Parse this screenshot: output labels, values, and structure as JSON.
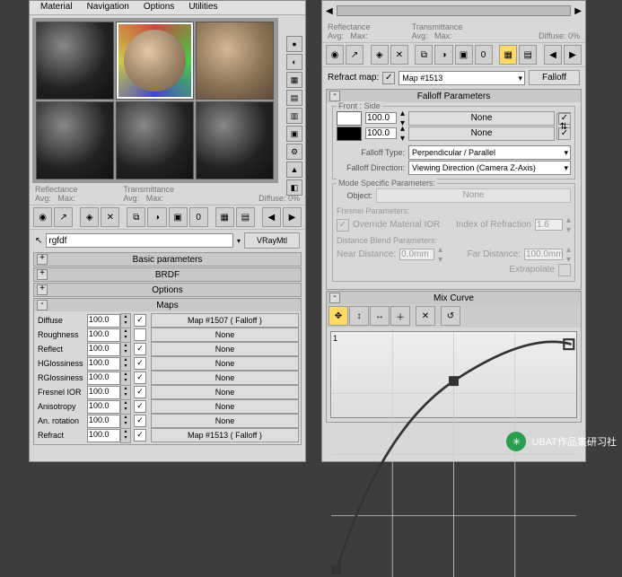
{
  "menu": {
    "material": "Material",
    "navigation": "Navigation",
    "options": "Options",
    "utilities": "Utilities"
  },
  "stats": {
    "reflect": "Reflectance",
    "transmit": "Transmittance",
    "avg": "Avg:",
    "max": "Max:",
    "diffuse": "Diffuse:",
    "diffuseVal": "0%"
  },
  "name": {
    "value": "rgfdf",
    "type": "VRayMtl"
  },
  "rollups": {
    "basic": "Basic parameters",
    "brdf": "BRDF",
    "options": "Options",
    "maps": "Maps"
  },
  "maps": {
    "diffuse": {
      "lbl": "Diffuse",
      "v": "100.0",
      "btn": "Map #1507 ( Falloff )"
    },
    "roughness": {
      "lbl": "Roughness",
      "v": "100.0",
      "btn": "None"
    },
    "reflect": {
      "lbl": "Reflect",
      "v": "100.0",
      "btn": "None"
    },
    "hgloss": {
      "lbl": "HGlossiness",
      "v": "100.0",
      "btn": "None"
    },
    "rgloss": {
      "lbl": "RGlossiness",
      "v": "100.0",
      "btn": "None"
    },
    "fresnel": {
      "lbl": "Fresnel IOR",
      "v": "100.0",
      "btn": "None"
    },
    "aniso": {
      "lbl": "Anisotropy",
      "v": "100.0",
      "btn": "None"
    },
    "anirot": {
      "lbl": "An. rotation",
      "v": "100.0",
      "btn": "None"
    },
    "refract": {
      "lbl": "Refract",
      "v": "100.0",
      "btn": "Map #1513 ( Falloff )"
    }
  },
  "right": {
    "refractLbl": "Refract map:",
    "refractCb": "✓",
    "mapDrop": "Map #1513",
    "falloffBtn": "Falloff",
    "falloffParams": "Falloff Parameters",
    "frontSide": "Front : Side",
    "v1": "100.0",
    "btn1": "None",
    "v2": "100.0",
    "btn2": "None",
    "falloffTypeLbl": "Falloff Type:",
    "falloffType": "Perpendicular / Parallel",
    "falloffDirLbl": "Falloff Direction:",
    "falloffDir": "Viewing Direction (Camera Z-Axis)",
    "modeParams": "Mode Specific Parameters:",
    "objectLbl": "Object:",
    "objectBtn": "None",
    "fresnelLbl": "Fresnel Parameters:",
    "overrideIOR": "Override Material IOR",
    "iorLbl": "Index of Refraction",
    "iorVal": "1.6",
    "distLbl": "Distance Blend Parameters:",
    "nearLbl": "Near Distance:",
    "nearVal": "0.0mm",
    "farLbl": "Far Distance:",
    "farVal": "100.0mm",
    "extrapLbl": "Extrapolate",
    "mixCurve": "Mix Curve"
  },
  "chart_data": {
    "type": "line",
    "title": "Mix Curve",
    "x": [
      0,
      0.25,
      0.5,
      0.75,
      1.0
    ],
    "values": [
      0.0,
      0.55,
      0.8,
      0.93,
      1.0
    ],
    "xlabel": "",
    "ylabel": "",
    "xlim": [
      0,
      1
    ],
    "ylim": [
      0,
      1
    ]
  },
  "watermark": "UBAT作品集研习社"
}
